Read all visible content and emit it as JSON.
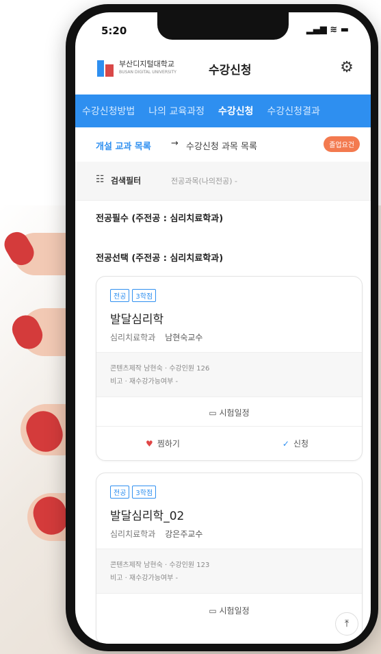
{
  "status": {
    "time": "5:20",
    "icons": "▂▄▆ ≋ ▬"
  },
  "header": {
    "logo_text": "부산디지털대학교",
    "logo_sub": "BUSAN DIGITAL UNIVERSITY",
    "title": "수강신청",
    "settings_icon": "gear-icon"
  },
  "tabs": [
    {
      "label": "수강신청방법"
    },
    {
      "label": "나의 교육과정"
    },
    {
      "label": "수강신청"
    },
    {
      "label": "수강신청결과"
    }
  ],
  "subnav": {
    "left": "개설 교과 목록",
    "arrow": "→",
    "right": "수강신청 과목 목록",
    "badge": "졸업요건"
  },
  "filter": {
    "label": "검색필터",
    "value": "전공과목(나의전공) -"
  },
  "sections": {
    "required": "전공필수 (주전공 : 심리치료학과)",
    "elective": "전공선택 (주전공 : 심리치료학과)"
  },
  "courses": [
    {
      "tag1": "전공",
      "tag2": "3학점",
      "name": "발달심리학",
      "dept": "심리치료학과",
      "prof": "남현숙교수",
      "meta1": "콘텐츠제작 남현숙 · 수강인원 126",
      "meta2": "비고 · 재수강가능여부 -",
      "exam": "시험일정",
      "like": "찜하기",
      "apply": "신청"
    },
    {
      "tag1": "전공",
      "tag2": "3학점",
      "name": "발달심리학_02",
      "dept": "심리치료학과",
      "prof": "강은주교수",
      "meta1": "콘텐츠제작 남현숙 · 수강인원 123",
      "meta2": "비고 · 재수강가능여부 -",
      "exam": "시험일정"
    }
  ],
  "top_button": "top-arrow-icon",
  "colors": {
    "accent": "#2e8ff0",
    "badge": "#f37a4f",
    "heart": "#e04646"
  }
}
